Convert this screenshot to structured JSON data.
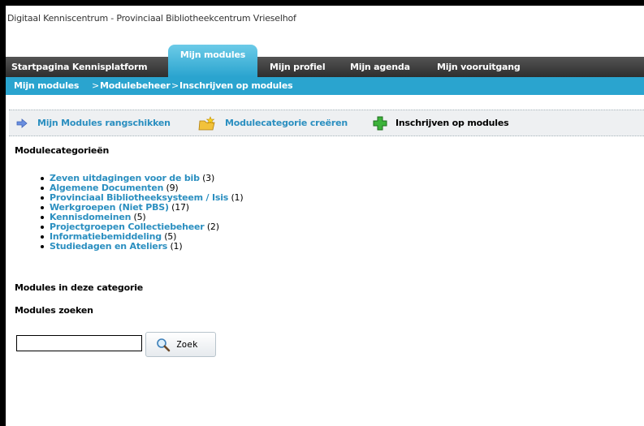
{
  "site_title": "Digitaal Kenniscentrum - Provinciaal Bibliotheekcentrum Vrieselhof",
  "nav": {
    "home": "Startpagina Kennisplatform",
    "active": "Mijn modules",
    "profile": "Mijn profiel",
    "agenda": "Mijn agenda",
    "progress": "Mijn vooruitgang"
  },
  "breadcrumb": {
    "items": [
      "Mijn modules",
      "Modulebeheer",
      "Inschrijven op modules"
    ],
    "separator": ">"
  },
  "toolbar": {
    "arrange": "Mijn Modules rangschikken",
    "create_category": "Modulecategorie creëren",
    "subscribe": "Inschrijven op modules"
  },
  "categories": {
    "heading": "Modulecategorieën",
    "items": [
      {
        "name": "Zeven uitdagingen voor de bib",
        "count": "(3)"
      },
      {
        "name": "Algemene Documenten",
        "count": "(9)"
      },
      {
        "name": "Provinciaal Bibliotheeksysteem / Isis",
        "count": "(1)"
      },
      {
        "name": "Werkgroepen (Niet PBS)",
        "count": "(17)"
      },
      {
        "name": "Kennisdomeinen",
        "count": "(5)"
      },
      {
        "name": "Projectgroepen Collectiebeheer",
        "count": "(2)"
      },
      {
        "name": "Informatiebemiddeling",
        "count": "(5)"
      },
      {
        "name": "Studiedagen en Ateliers",
        "count": "(1)"
      }
    ]
  },
  "modules_heading": "Modules in deze categorie",
  "search": {
    "heading": "Modules zoeken",
    "value": "",
    "button": "Zoek"
  },
  "colors": {
    "accent": "#2aa4cf",
    "link": "#2b8fc0",
    "nav_dark": "#3a3a3a"
  },
  "icons": {
    "arrange": "arrow-right-icon",
    "create_category": "folder-star-icon",
    "subscribe": "green-plus-icon",
    "search": "magnifier-icon"
  }
}
